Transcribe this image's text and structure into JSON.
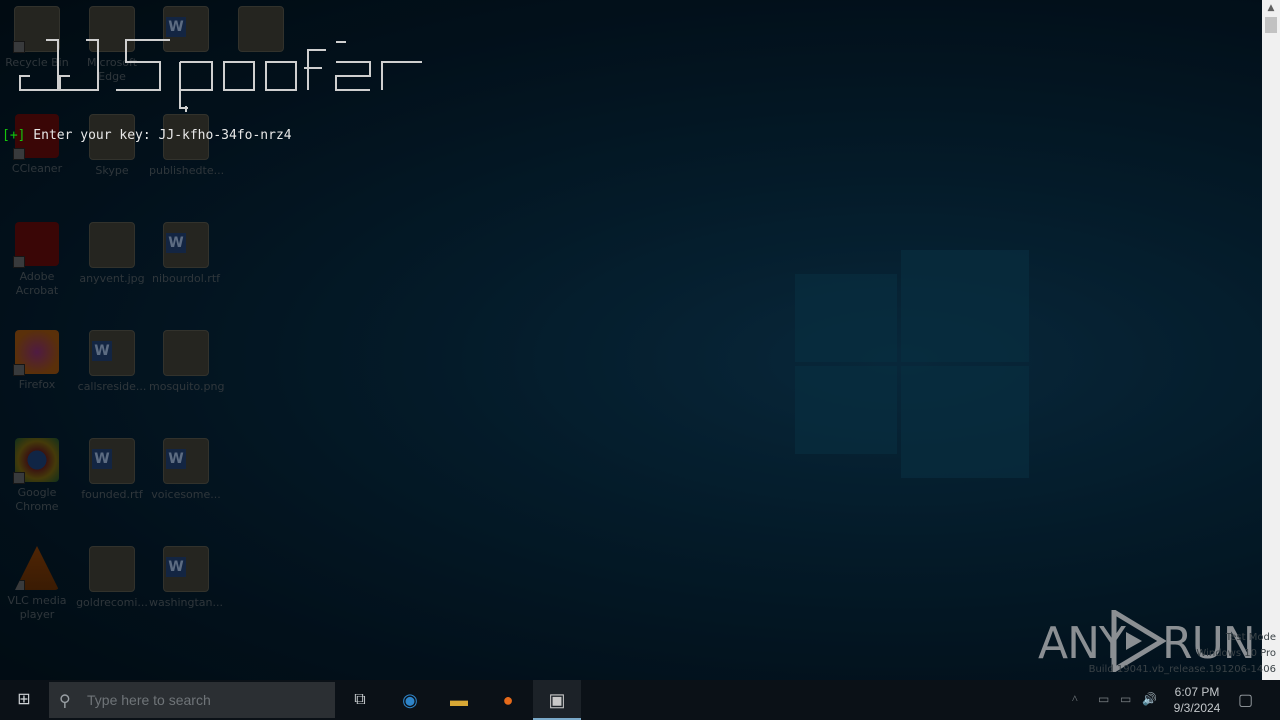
{
  "desktop": {
    "icons": [
      {
        "label": "Recycle Bin",
        "type": "doc"
      },
      {
        "label": "Microsoft Edge",
        "type": "doc"
      },
      {
        "label": "",
        "type": "word"
      },
      {
        "label": "",
        "type": "doc"
      },
      {
        "label": "CCleaner",
        "type": "acro"
      },
      {
        "label": "Skype",
        "type": "doc"
      },
      {
        "label": "publishedte...",
        "type": "doc"
      },
      {
        "label": "Adobe Acrobat",
        "type": "acro"
      },
      {
        "label": "anyvent.jpg",
        "type": "doc"
      },
      {
        "label": "nibourdol.rtf",
        "type": "word"
      },
      {
        "label": "Firefox",
        "type": "ff"
      },
      {
        "label": "callsreside...",
        "type": "word"
      },
      {
        "label": "mosquito.png",
        "type": "doc"
      },
      {
        "label": "Google Chrome",
        "type": "chrome"
      },
      {
        "label": "founded.rtf",
        "type": "word"
      },
      {
        "label": "voicesome...",
        "type": "word"
      },
      {
        "label": "VLC media player",
        "type": "vlc"
      },
      {
        "label": "goldrecomi...",
        "type": "doc"
      },
      {
        "label": "washingtan...",
        "type": "word"
      }
    ]
  },
  "console": {
    "banner_text": "JJ Spoofer",
    "prompt_prefix": "[+]",
    "prompt_label": " Enter your key: ",
    "prompt_value": "JJ-kfho-34fo-nrz4"
  },
  "scrollbar": {
    "up_glyph": "▲"
  },
  "watermark": {
    "left": "ANY",
    "right": "RUN",
    "build_line1": "Test Mode",
    "build_line2": "Windows 10 Pro",
    "build_line3": "Build 19041.vb_release.191206-1406"
  },
  "taskbar": {
    "start_glyph": "⊞",
    "search_placeholder": "Type here to search",
    "search_glyph": "⚲",
    "task_view_glyph": "⧉",
    "apps": [
      {
        "name": "edge",
        "glyph": "◉",
        "color": "#2e84c9"
      },
      {
        "name": "file-explorer",
        "glyph": "▬",
        "color": "#d8a835"
      },
      {
        "name": "firefox",
        "glyph": "●",
        "color": "#e66a1a"
      },
      {
        "name": "console",
        "glyph": "▣",
        "color": "#c9c9c9"
      }
    ],
    "tray": {
      "chevron": "^",
      "net": "▭",
      "vol": "🔊"
    },
    "time": "6:07 PM",
    "date": "9/3/2024",
    "notify_glyph": "▢"
  }
}
